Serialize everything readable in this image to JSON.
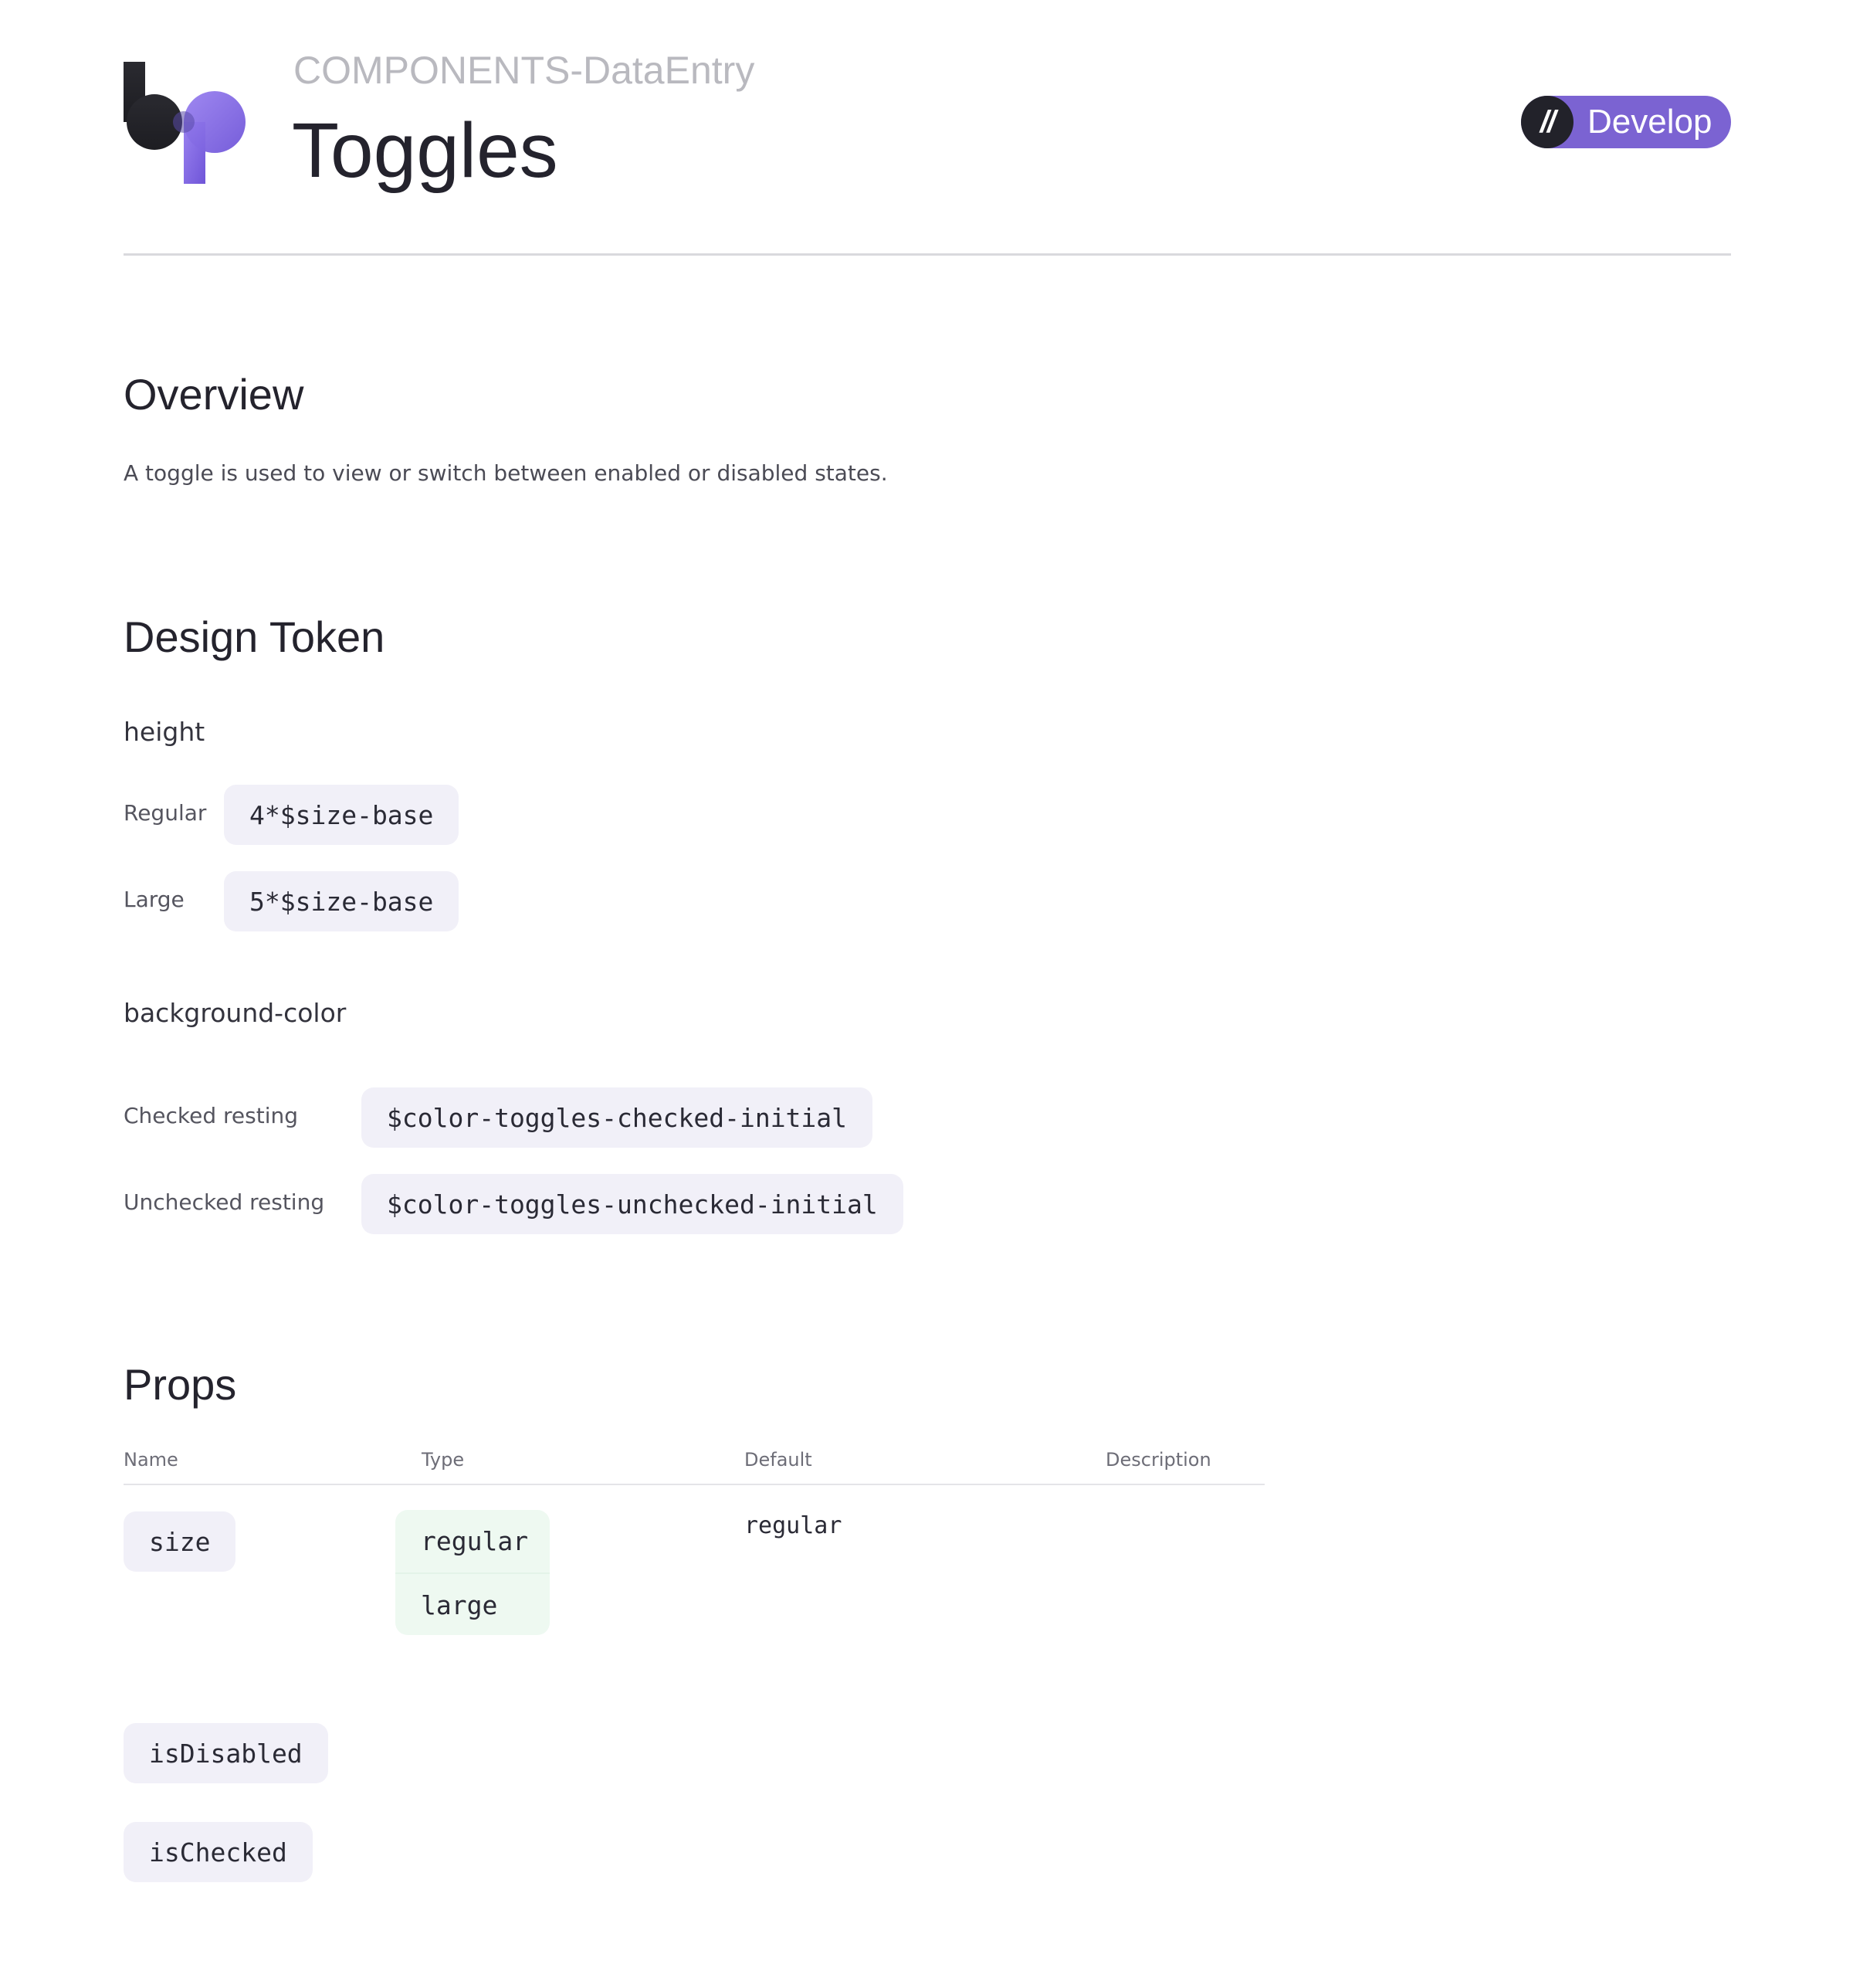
{
  "header": {
    "breadcrumb": "COMPONENTS-DataEntry",
    "title": "Toggles",
    "badge": {
      "icon": "//",
      "label": "Develop"
    },
    "logo_icon": "bp-logo-icon"
  },
  "overview": {
    "title": "Overview",
    "description": "A toggle is used to view or switch between enabled or disabled states."
  },
  "design_token": {
    "title": "Design Token",
    "height": {
      "title": "height",
      "rows": [
        {
          "label": "Regular",
          "value": "4*$size-base"
        },
        {
          "label": "Large",
          "value": "5*$size-base"
        }
      ]
    },
    "background_color": {
      "title": "background-color",
      "rows": [
        {
          "label": "Checked resting",
          "value": "$color-toggles-checked-initial"
        },
        {
          "label": "Unchecked resting",
          "value": "$color-toggles-unchecked-initial"
        }
      ]
    }
  },
  "props": {
    "title": "Props",
    "columns": [
      "Name",
      "Type",
      "Default",
      "Description"
    ],
    "rows": [
      {
        "name": "size",
        "types": [
          "regular",
          "large"
        ],
        "default": "regular",
        "description": ""
      },
      {
        "name": "isDisabled"
      },
      {
        "name": "isChecked"
      }
    ]
  },
  "colors": {
    "accent": "#7b63d2",
    "dark": "#22222a",
    "chip_bg": "#f1f0f8",
    "type_bg": "#eef9f1"
  }
}
